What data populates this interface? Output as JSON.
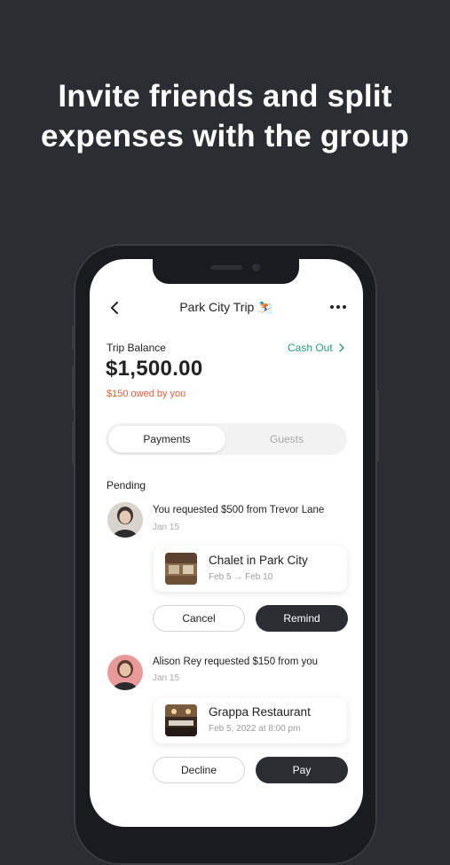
{
  "headline": {
    "line1": "Invite friends and split",
    "line2": "expenses with the group"
  },
  "nav": {
    "title": "Park City Trip ⛷️",
    "back_icon": "chevron-left-icon",
    "more_icon": "more-horizontal-icon"
  },
  "balance": {
    "label": "Trip Balance",
    "amount": "$1,500.00",
    "owed": "$150 owed by you",
    "cash_out": "Cash Out",
    "owed_color": "#e2613e",
    "accent_color": "#2a9d7f"
  },
  "tabs": {
    "active": "Payments",
    "inactive": "Guests"
  },
  "section": {
    "title": "Pending"
  },
  "requests": [
    {
      "text": "You requested $500 from Trevor Lane",
      "date": "Jan 15",
      "card_title": "Chalet in Park City",
      "card_sub": "Feb 5 → Feb 10",
      "secondary_button": "Cancel",
      "primary_button": "Remind"
    },
    {
      "text": "Alison Rey requested $150 from you",
      "date": "Jan 15",
      "card_title": "Grappa Restaurant",
      "card_sub": "Feb 5, 2022 at 8:00 pm",
      "secondary_button": "Decline",
      "primary_button": "Pay"
    }
  ]
}
